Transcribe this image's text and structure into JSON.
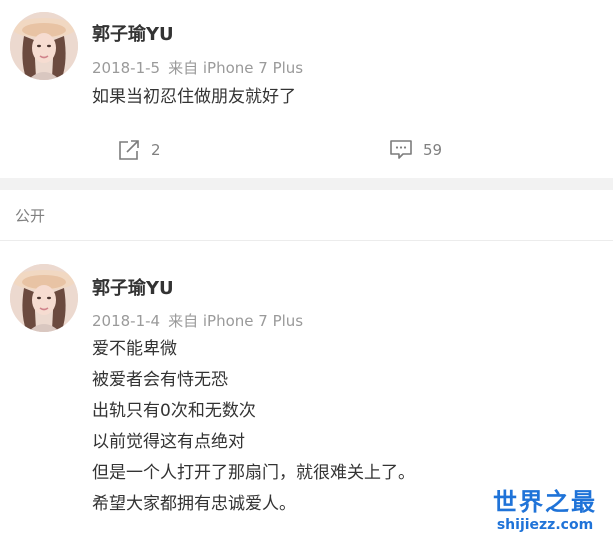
{
  "posts": [
    {
      "author": "郭子瑜YU",
      "date": "2018-1-5",
      "source": "来自 iPhone 7 Plus",
      "content": [
        "如果当初忍住做朋友就好了"
      ],
      "shares": "2",
      "comments": "59"
    },
    {
      "author": "郭子瑜YU",
      "date": "2018-1-4",
      "source": "来自 iPhone 7 Plus",
      "content": [
        "爱不能卑微",
        "被爱者会有恃无恐",
        "出轨只有0次和无数次",
        "以前觉得这有点绝对",
        "但是一个人打开了那扇门，就很难关上了。",
        "希望大家都拥有忠诚爱人。"
      ]
    }
  ],
  "section_label": "公开",
  "watermark": {
    "title": "世界之最",
    "domain": "shijiezz.com"
  },
  "icons": {
    "share": "share-icon",
    "comment": "comment-icon"
  },
  "colors": {
    "text": "#333333",
    "muted": "#9a9a9a",
    "watermark": "#1f73d8",
    "band": "#f2f2f2"
  }
}
